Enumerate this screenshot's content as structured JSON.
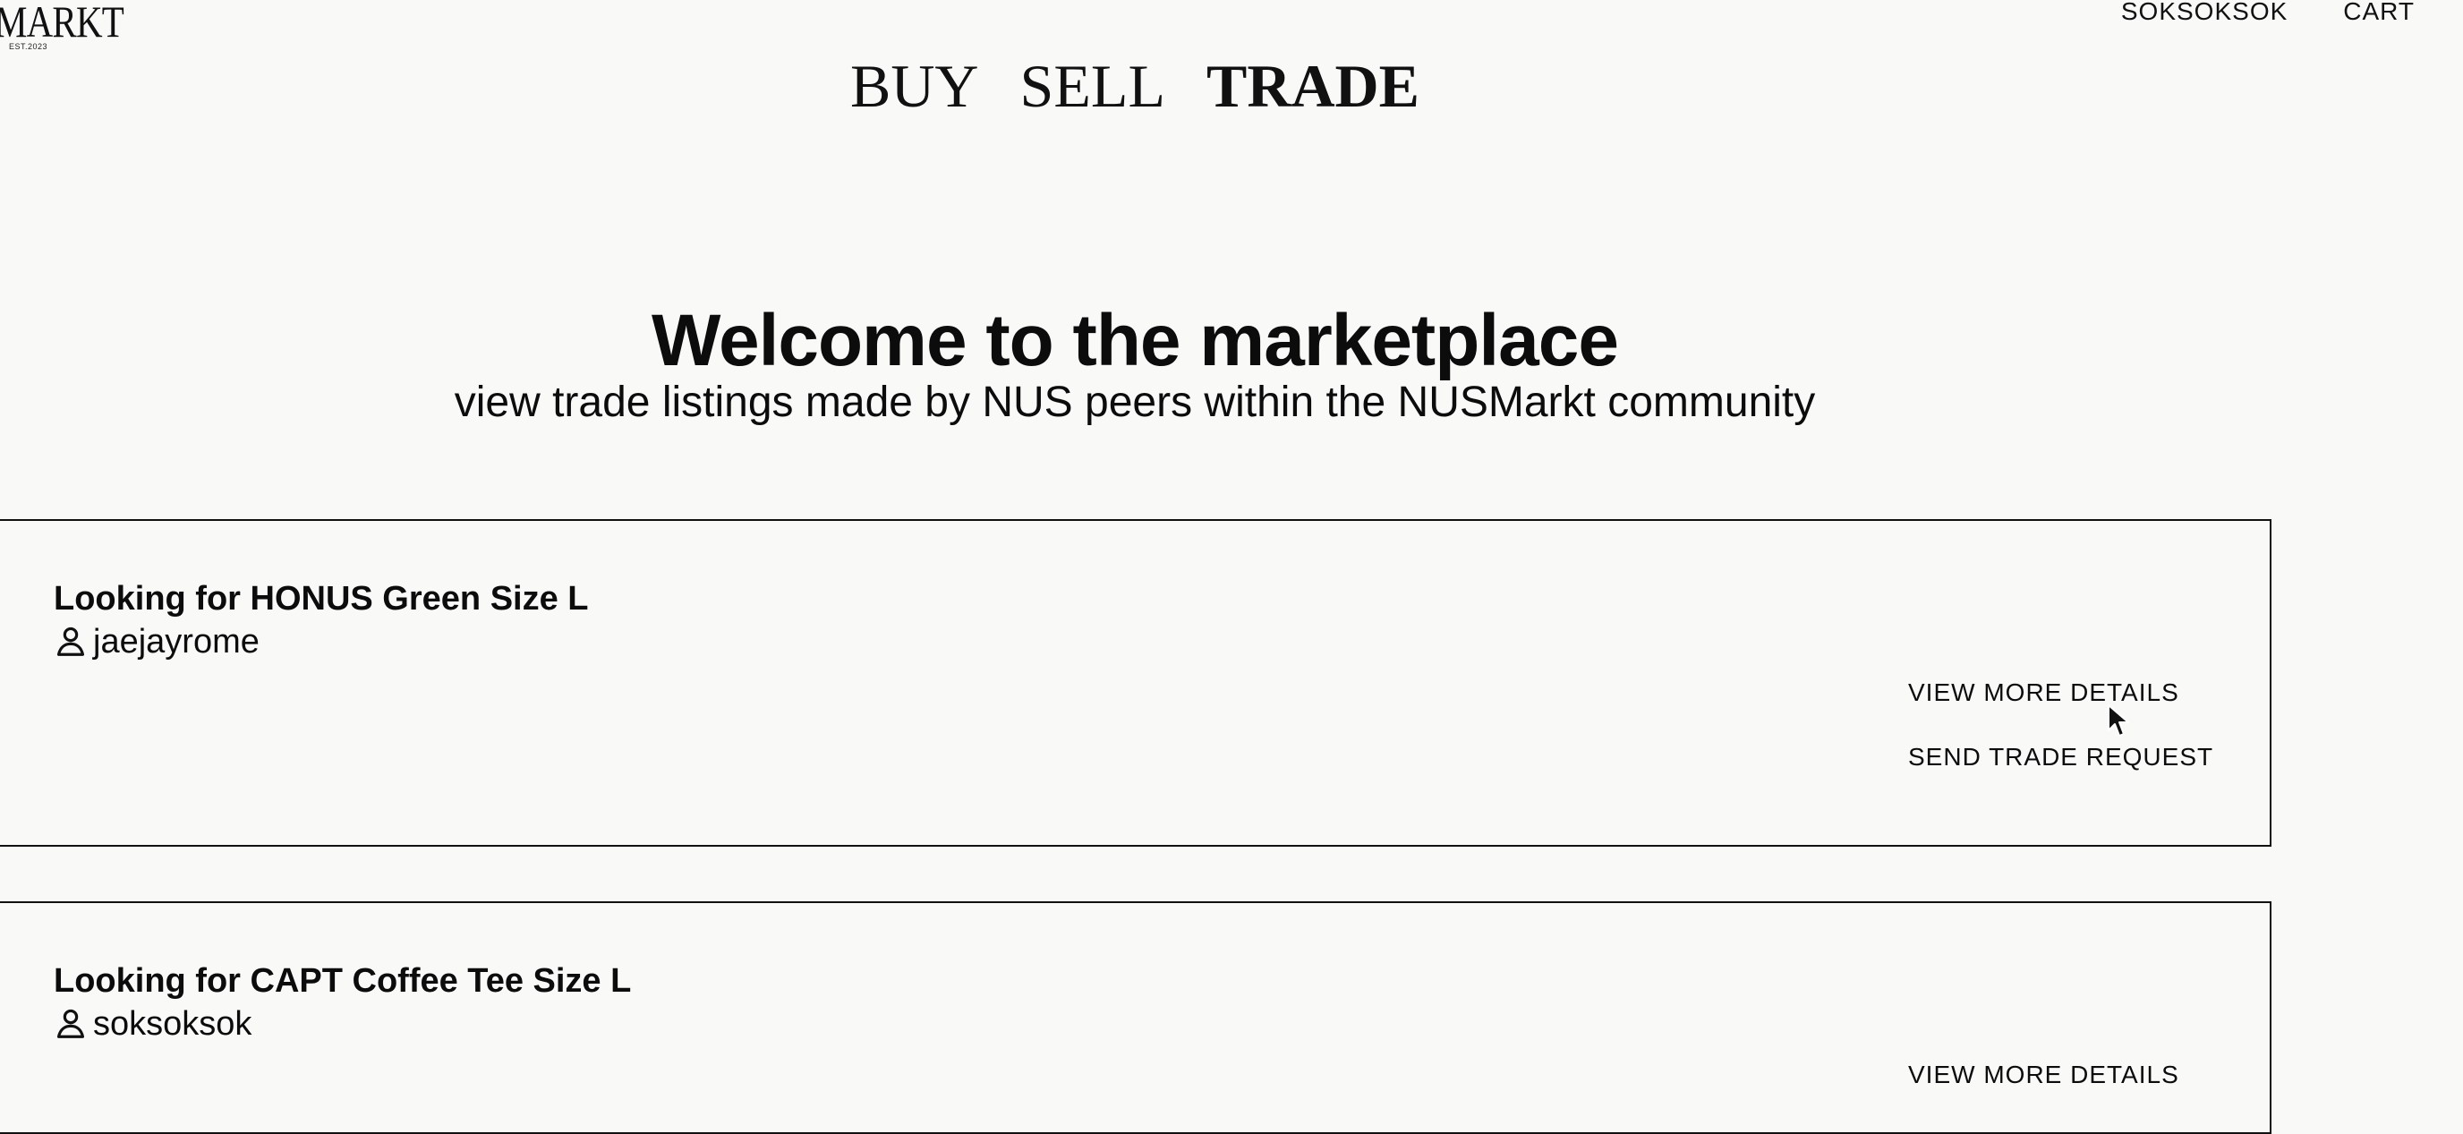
{
  "logo": {
    "text": "MARKT",
    "est": "EST.2023"
  },
  "header": {
    "user_link": "SOKSOKSOK",
    "cart_link": "CART"
  },
  "mode_nav": {
    "tabs": [
      "BUY",
      "SELL",
      "TRADE"
    ],
    "active": "TRADE"
  },
  "hero": {
    "title": "Welcome to the marketplace",
    "subtitle": "view trade listings made by NUS peers within the NUSMarkt community"
  },
  "listings": [
    {
      "title": "Looking for HONUS Green Size L",
      "username": "jaejayrome",
      "view_details_label": "VIEW MORE DETAILS",
      "trade_request_label": "SEND TRADE REQUEST"
    },
    {
      "title": "Looking for CAPT Coffee Tee Size L",
      "username": "soksoksok",
      "view_details_label": "VIEW MORE DETAILS"
    }
  ],
  "icons": {
    "user": "user-icon",
    "cursor": "mouse-pointer-icon"
  }
}
